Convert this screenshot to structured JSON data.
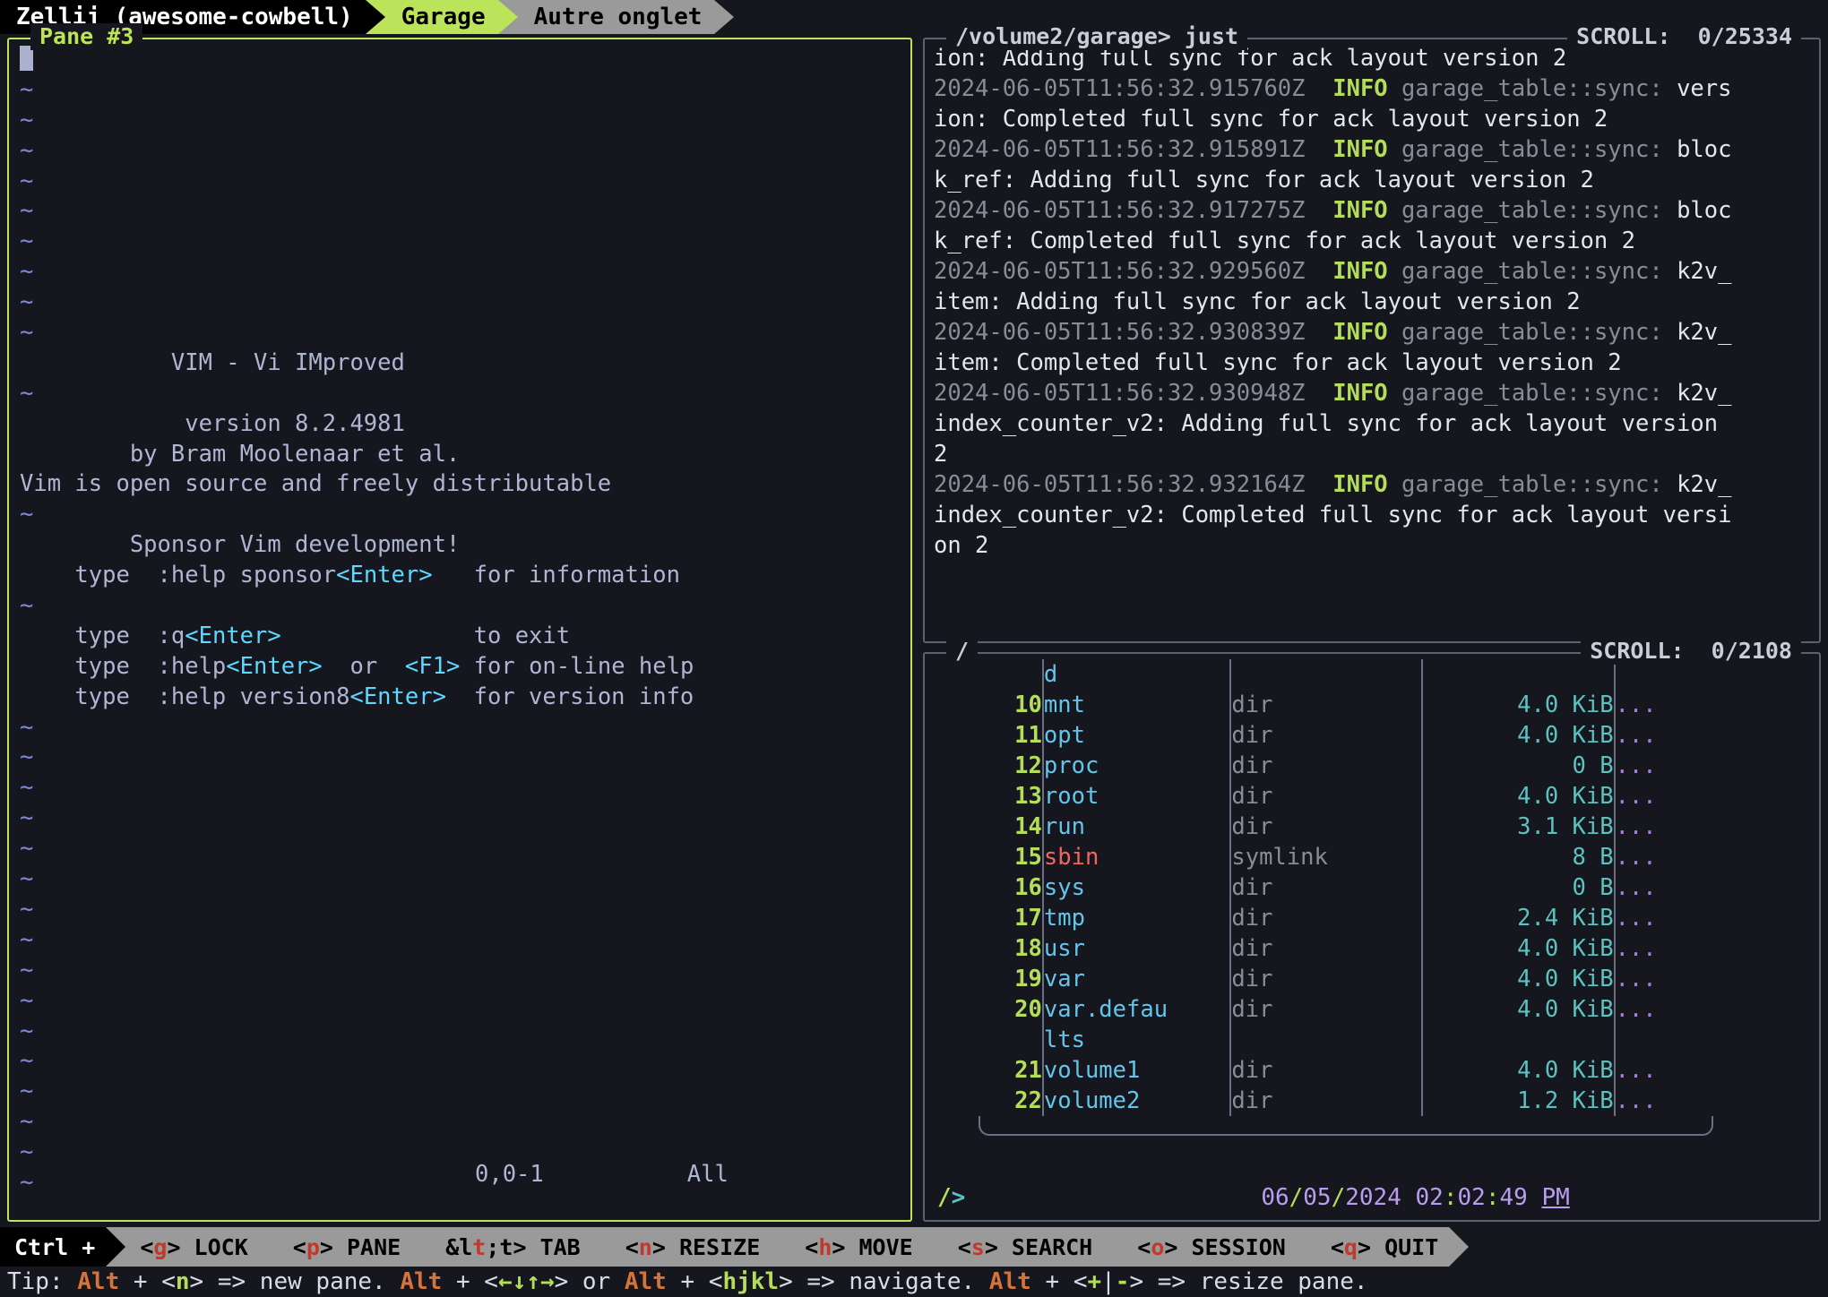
{
  "tabbar": {
    "session": "Zellij (awesome-cowbell)",
    "tabs": [
      {
        "label": "Garage",
        "active": true
      },
      {
        "label": "Autre onglet",
        "active": false
      }
    ]
  },
  "panes": {
    "vim": {
      "title": "Pane #3",
      "active": true,
      "splash": {
        "title": "VIM - Vi IMproved",
        "version": "version 8.2.4981",
        "author": "by Bram Moolenaar et al.",
        "license": "Vim is open source and freely distributable",
        "sponsor": "Sponsor Vim development!",
        "help_lines": [
          {
            "pre": "type  :help sponsor",
            "key": "<Enter>",
            "post": "   for information"
          },
          {
            "pre": "type  :q",
            "key": "<Enter>",
            "post": "              to exit"
          },
          {
            "pre": "type  :help",
            "key": "<Enter>",
            "mid": "  or  ",
            "key2": "<F1>",
            "post": " for on-line help"
          },
          {
            "pre": "type  :help version8",
            "key": "<Enter>",
            "post": "  for version info"
          }
        ]
      },
      "status_left": "0,0-1",
      "status_right": "All",
      "tilde": "~"
    },
    "log": {
      "title": "/volume2/garage> just",
      "scroll": "SCROLL:  0/25334",
      "lines": [
        {
          "type": "cont",
          "text": "ion: Adding full sync for ack layout version 2"
        },
        {
          "type": "entry",
          "ts": "2024-06-05T11:56:32.915760Z",
          "level": "INFO",
          "module": "garage_table::sync:",
          "msg": "vers"
        },
        {
          "type": "cont",
          "text": "ion: Completed full sync for ack layout version 2"
        },
        {
          "type": "entry",
          "ts": "2024-06-05T11:56:32.915891Z",
          "level": "INFO",
          "module": "garage_table::sync:",
          "msg": "bloc"
        },
        {
          "type": "cont",
          "text": "k_ref: Adding full sync for ack layout version 2"
        },
        {
          "type": "entry",
          "ts": "2024-06-05T11:56:32.917275Z",
          "level": "INFO",
          "module": "garage_table::sync:",
          "msg": "bloc"
        },
        {
          "type": "cont",
          "text": "k_ref: Completed full sync for ack layout version 2"
        },
        {
          "type": "entry",
          "ts": "2024-06-05T11:56:32.929560Z",
          "level": "INFO",
          "module": "garage_table::sync:",
          "msg": "k2v_"
        },
        {
          "type": "cont",
          "text": "item: Adding full sync for ack layout version 2"
        },
        {
          "type": "entry",
          "ts": "2024-06-05T11:56:32.930839Z",
          "level": "INFO",
          "module": "garage_table::sync:",
          "msg": "k2v_"
        },
        {
          "type": "cont",
          "text": "item: Completed full sync for ack layout version 2"
        },
        {
          "type": "entry",
          "ts": "2024-06-05T11:56:32.930948Z",
          "level": "INFO",
          "module": "garage_table::sync:",
          "msg": "k2v_"
        },
        {
          "type": "cont",
          "text": "index_counter_v2: Adding full sync for ack layout version"
        },
        {
          "type": "cont",
          "text": "2"
        },
        {
          "type": "entry",
          "ts": "2024-06-05T11:56:32.932164Z",
          "level": "INFO",
          "module": "garage_table::sync:",
          "msg": "k2v_"
        },
        {
          "type": "cont",
          "text": "index_counter_v2: Completed full sync for ack layout versi"
        },
        {
          "type": "cont",
          "text": "on 2"
        }
      ]
    },
    "files": {
      "title": "/",
      "scroll": "SCROLL:  0/2108",
      "header_fragment": "d",
      "rows": [
        {
          "num": "10",
          "name": "mnt",
          "type": "dir",
          "size": "4.0 KiB",
          "dots": "...",
          "symlink": false
        },
        {
          "num": "11",
          "name": "opt",
          "type": "dir",
          "size": "4.0 KiB",
          "dots": "...",
          "symlink": false
        },
        {
          "num": "12",
          "name": "proc",
          "type": "dir",
          "size": "0 B",
          "dots": "...",
          "symlink": false
        },
        {
          "num": "13",
          "name": "root",
          "type": "dir",
          "size": "4.0 KiB",
          "dots": "...",
          "symlink": false
        },
        {
          "num": "14",
          "name": "run",
          "type": "dir",
          "size": "3.1 KiB",
          "dots": "...",
          "symlink": false
        },
        {
          "num": "15",
          "name": "sbin",
          "type": "symlink",
          "size": "8 B",
          "dots": "...",
          "symlink": true
        },
        {
          "num": "16",
          "name": "sys",
          "type": "dir",
          "size": "0 B",
          "dots": "...",
          "symlink": false
        },
        {
          "num": "17",
          "name": "tmp",
          "type": "dir",
          "size": "2.4 KiB",
          "dots": "...",
          "symlink": false
        },
        {
          "num": "18",
          "name": "usr",
          "type": "dir",
          "size": "4.0 KiB",
          "dots": "...",
          "symlink": false
        },
        {
          "num": "19",
          "name": "var",
          "type": "dir",
          "size": "4.0 KiB",
          "dots": "...",
          "symlink": false
        },
        {
          "num": "20",
          "name": "var.defau",
          "name2": "lts",
          "type": "dir",
          "size": "4.0 KiB",
          "dots": "...",
          "symlink": false
        },
        {
          "num": "21",
          "name": "volume1",
          "type": "dir",
          "size": "4.0 KiB",
          "dots": "...",
          "symlink": false
        },
        {
          "num": "22",
          "name": "volume2",
          "type": "dir",
          "size": "1.2 KiB",
          "dots": "...",
          "symlink": false
        }
      ],
      "prompt": {
        "slash": "/",
        "gt": ">",
        "date": "06/05/2024",
        "time": "02:02:49",
        "ampm": "PM"
      }
    }
  },
  "statusbar": {
    "ctrl_label": "Ctrl +",
    "keys": [
      {
        "key": "<g>",
        "hot": "g",
        "label": "LOCK"
      },
      {
        "key": "<p>",
        "hot": "p",
        "label": "PANE"
      },
      {
        "key": "<t>",
        "hot": "t",
        "label": "TAB"
      },
      {
        "key": "<n>",
        "hot": "n",
        "label": "RESIZE"
      },
      {
        "key": "<h>",
        "hot": "h",
        "label": "MOVE"
      },
      {
        "key": "<s>",
        "hot": "s",
        "label": "SEARCH"
      },
      {
        "key": "<o>",
        "hot": "o",
        "label": "SESSION"
      },
      {
        "key": "<q>",
        "hot": "q",
        "label": "QUIT"
      }
    ],
    "tip": {
      "prefix": "Tip: ",
      "alt1": "Alt",
      "seg1": " + ",
      "n": "<n>",
      "seg2": " => new pane. ",
      "alt2": "Alt",
      "seg3": " + ",
      "arrows": "<←↓↑→>",
      "seg4": " or ",
      "alt3": "Alt",
      "seg5": " + ",
      "hjkl": "<hjkl>",
      "seg6": " => navigate. ",
      "alt4": "Alt",
      "seg7": " + ",
      "plus": "<+",
      "bar": "|",
      "minus": "-",
      "gt": ">",
      "seg8": " => resize pane."
    }
  },
  "colors": {
    "accent_green": "#bce45a",
    "bg": "#16161f",
    "inactive_tab": "#9a9a9a",
    "border_inactive": "#5c6370"
  }
}
